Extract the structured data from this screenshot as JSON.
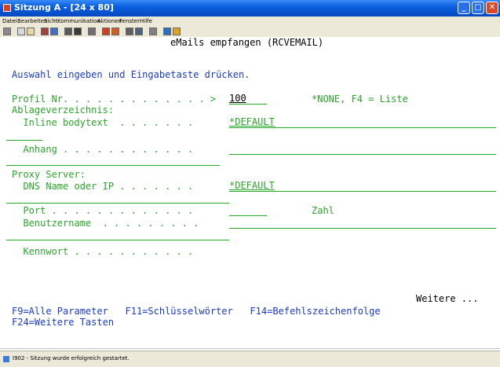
{
  "window": {
    "title": "Sitzung A - [24 x 80]"
  },
  "menu": [
    "Datei",
    "Bearbeiten",
    "Sicht",
    "Kommunikation",
    "Aktionen",
    "Fenster",
    "Hilfe"
  ],
  "toolbar_icons": [
    "print-icon",
    "copy-icon",
    "paste-icon",
    "send-icon",
    "receive-icon",
    "display-icon",
    "keyboard-icon",
    "record-icon",
    "macro-icon",
    "play-icon",
    "stop-icon",
    "clipboard-icon",
    "map-icon",
    "help-icon"
  ],
  "screen": {
    "heading": "eMails empfangen (RCVEMAIL)",
    "instruction": "Auswahl eingeben und Eingabetaste drücken.",
    "profile_label": "Profil Nr. . . . . . . . . . . . . >",
    "profile_value": "100",
    "profile_hint": "*NONE, F4 = Liste",
    "storage_dir_label": "Ablageverzeichnis:",
    "inline_label": "  Inline bodytext  . . . . . . .",
    "inline_value": "*DEFAULT",
    "attachment_label": "  Anhang . . . . . . . . . . . .",
    "attachment_value": "",
    "proxy_label": "Proxy Server:",
    "dns_label": "  DNS Name oder IP . . . . . . .",
    "dns_value": "*DEFAULT",
    "port_label": "  Port . . . . . . . . . . . . .",
    "port_value": "",
    "port_hint": "Zahl",
    "user_label": "  Benutzername  . . . . . . . . .",
    "user_value": "",
    "password_label": "  Kennwort . . . . . . . . . . .",
    "password_value": "",
    "more": "Weitere ...",
    "fkeys_line1": "F9=Alle Parameter   F11=Schlüsselwörter   F14=Befehlszeichenfolge",
    "fkeys_line2": "F24=Weitere Tasten"
  },
  "status": {
    "message": "I902 - Sitzung wurde erfolgreich gestartet."
  },
  "colors": {
    "field_green": "#2aa62a",
    "text_blue": "#1a3ad0",
    "titlebar": "#0a5fe0"
  }
}
